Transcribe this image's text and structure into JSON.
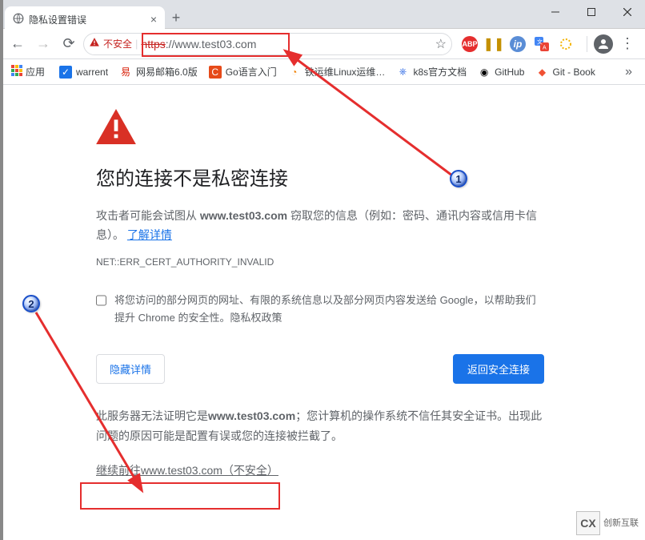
{
  "tab": {
    "title": "隐私设置错误"
  },
  "addr": {
    "insecure_label": "不安全",
    "url_scheme": "https",
    "url_rest": "://www.test03.com"
  },
  "bookmarks": {
    "apps_label": "应用",
    "items": [
      {
        "label": "warrent",
        "icon_bg": "#1a73e8",
        "icon_fg": "#fff",
        "icon_char": "✓"
      },
      {
        "label": "网易邮箱6.0版",
        "icon_bg": "#fff",
        "icon_fg": "#d81e06",
        "icon_char": "易"
      },
      {
        "label": "Go语言入门",
        "icon_bg": "#e64a19",
        "icon_fg": "#fff",
        "icon_char": "C"
      },
      {
        "label": "铁运维Linux运维…",
        "icon_bg": "#fff",
        "icon_fg": "#f08000",
        "icon_char": "◔"
      },
      {
        "label": "k8s官方文档",
        "icon_bg": "#fff",
        "icon_fg": "#326ce5",
        "icon_char": "⎈"
      },
      {
        "label": "GitHub",
        "icon_bg": "#fff",
        "icon_fg": "#000",
        "icon_char": "◉"
      },
      {
        "label": "Git - Book",
        "icon_bg": "#fff",
        "icon_fg": "#f05133",
        "icon_char": "◆"
      }
    ]
  },
  "page": {
    "heading": "您的连接不是私密连接",
    "desc_prefix": "攻击者可能会试图从 ",
    "desc_host": "www.test03.com",
    "desc_suffix": " 窃取您的信息（例如：密码、通讯内容或信用卡信息）。",
    "learn_more": "了解详情",
    "error_code": "NET::ERR_CERT_AUTHORITY_INVALID",
    "opt_in_prefix": "将",
    "opt_in_link": "您访问的部分网页的网址、有限的系统信息以及部分网页内容",
    "opt_in_suffix": "发送给 Google，以帮助我们提升 Chrome 的安全性。",
    "privacy_policy": "隐私权政策",
    "hide_details": "隐藏详情",
    "back_safety": "返回安全连接",
    "explain_p1a": "此服务器无法证明它是",
    "explain_host": "www.test03.com",
    "explain_p1b": "；您计算机的操作系统不信任其安全证书。出现此问题的原因可能是配置有误或您的连接被拦截了。",
    "proceed": "继续前往www.test03.com（不安全）"
  },
  "watermark": {
    "logo_text": "CX",
    "text": "创新互联"
  }
}
